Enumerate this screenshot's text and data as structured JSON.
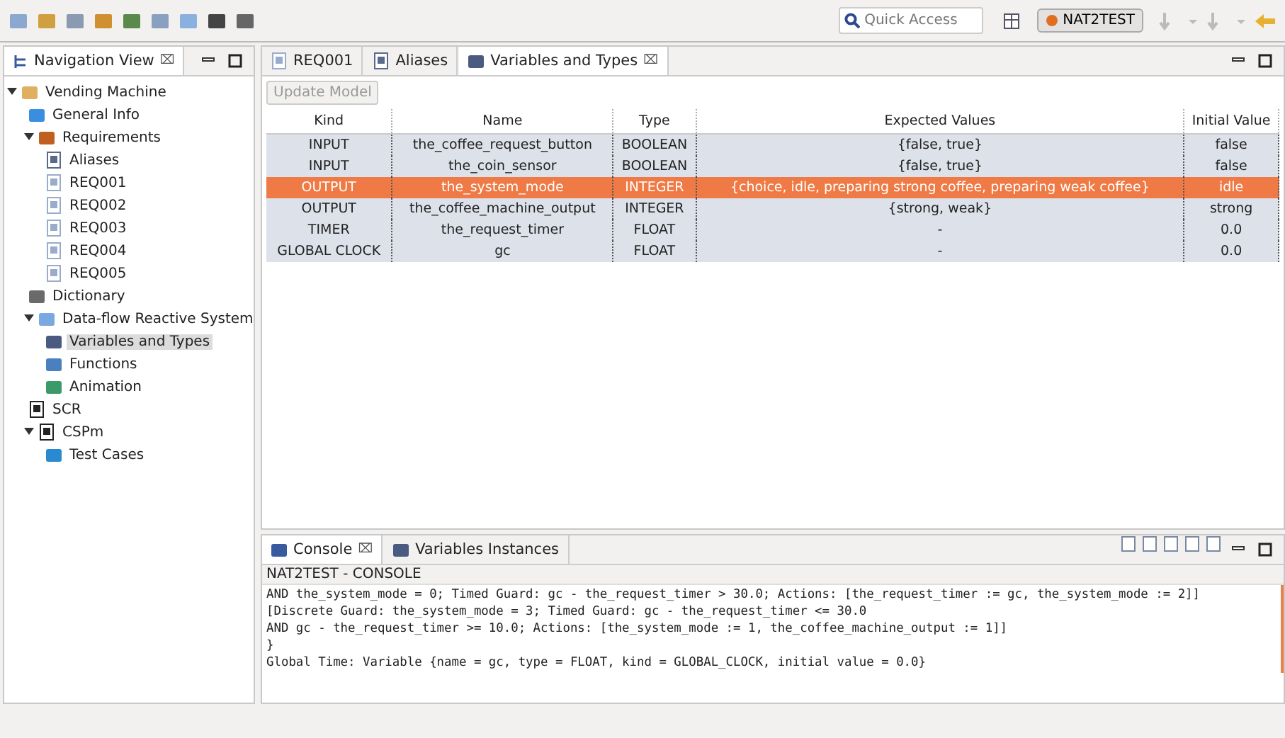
{
  "toolbar": {
    "search": {
      "placeholder": "Quick Access"
    },
    "perspective": {
      "label": "NAT2TEST",
      "selected": true
    }
  },
  "navigation": {
    "title": "Navigation View",
    "close": "⌧",
    "tree": [
      {
        "label": "Vending Machine",
        "kind": "folder",
        "expanded": true,
        "selected": false,
        "children": [
          {
            "label": "General Info",
            "kind": "info",
            "selected": false
          },
          {
            "label": "Requirements",
            "kind": "grid",
            "expanded": true,
            "selected": false,
            "children": [
              {
                "label": "Aliases",
                "kind": "alias",
                "selected": false
              },
              {
                "label": "REQ001",
                "kind": "doc",
                "selected": false
              },
              {
                "label": "REQ002",
                "kind": "doc",
                "selected": false
              },
              {
                "label": "REQ003",
                "kind": "doc",
                "selected": false
              },
              {
                "label": "REQ004",
                "kind": "doc",
                "selected": false
              },
              {
                "label": "REQ005",
                "kind": "doc",
                "selected": false
              }
            ]
          },
          {
            "label": "Dictionary",
            "kind": "book",
            "selected": false
          },
          {
            "label": "Data-flow Reactive System",
            "kind": "chart",
            "expanded": true,
            "selected": false,
            "children": [
              {
                "label": "Variables and Types",
                "kind": "var",
                "selected": true
              },
              {
                "label": "Functions",
                "kind": "func",
                "selected": false
              },
              {
                "label": "Animation",
                "kind": "anim",
                "selected": false
              }
            ]
          },
          {
            "label": "SCR",
            "kind": "scr",
            "selected": false
          },
          {
            "label": "CSPm",
            "kind": "cspm",
            "expanded": true,
            "selected": false,
            "children": [
              {
                "label": "Test Cases",
                "kind": "case",
                "selected": false
              }
            ]
          }
        ]
      }
    ]
  },
  "editor": {
    "tabs": [
      {
        "label": "REQ001",
        "kind": "doc",
        "selected": false
      },
      {
        "label": "Aliases",
        "kind": "alias",
        "selected": false
      },
      {
        "label": "Variables and Types",
        "kind": "var",
        "selected": true,
        "close": "⌧"
      }
    ],
    "button": {
      "label": "Update Model",
      "disabled": true
    },
    "table": {
      "columns": [
        "Kind",
        "Name",
        "Type",
        "Expected Values",
        "Initial Value"
      ],
      "rows": [
        {
          "cells": [
            "INPUT",
            "the_coffee_request_button",
            "BOOLEAN",
            "{false, true}",
            "false"
          ],
          "selected": false
        },
        {
          "cells": [
            "INPUT",
            "the_coin_sensor",
            "BOOLEAN",
            "{false, true}",
            "false"
          ],
          "selected": false
        },
        {
          "cells": [
            "OUTPUT",
            "the_system_mode",
            "INTEGER",
            "{choice, idle, preparing strong coffee, preparing weak coffee}",
            "idle"
          ],
          "selected": true
        },
        {
          "cells": [
            "OUTPUT",
            "the_coffee_machine_output",
            "INTEGER",
            "{strong, weak}",
            "strong"
          ],
          "selected": false
        },
        {
          "cells": [
            "TIMER",
            "the_request_timer",
            "FLOAT",
            "-",
            "0.0"
          ],
          "selected": false
        },
        {
          "cells": [
            "GLOBAL CLOCK",
            "gc",
            "FLOAT",
            "-",
            "0.0"
          ],
          "selected": false
        }
      ]
    }
  },
  "console": {
    "tabs": [
      {
        "label": "Console",
        "kind": "console",
        "selected": true,
        "close": "⌧"
      },
      {
        "label": "Variables Instances",
        "kind": "var",
        "selected": false
      }
    ],
    "title": "NAT2TEST - CONSOLE",
    "lines": [
      "AND the_system_mode = 0; Timed Guard: gc - the_request_timer > 30.0; Actions: [the_request_timer := gc, the_system_mode := 2]]",
      "[Discrete Guard: the_system_mode = 3; Timed Guard: gc - the_request_timer <= 30.0",
      "AND gc - the_request_timer >= 10.0; Actions: [the_system_mode := 1, the_coffee_machine_output := 1]]",
      "}",
      "Global Time: Variable {name = gc, type = FLOAT, kind = GLOBAL_CLOCK, initial value = 0.0}"
    ]
  }
}
